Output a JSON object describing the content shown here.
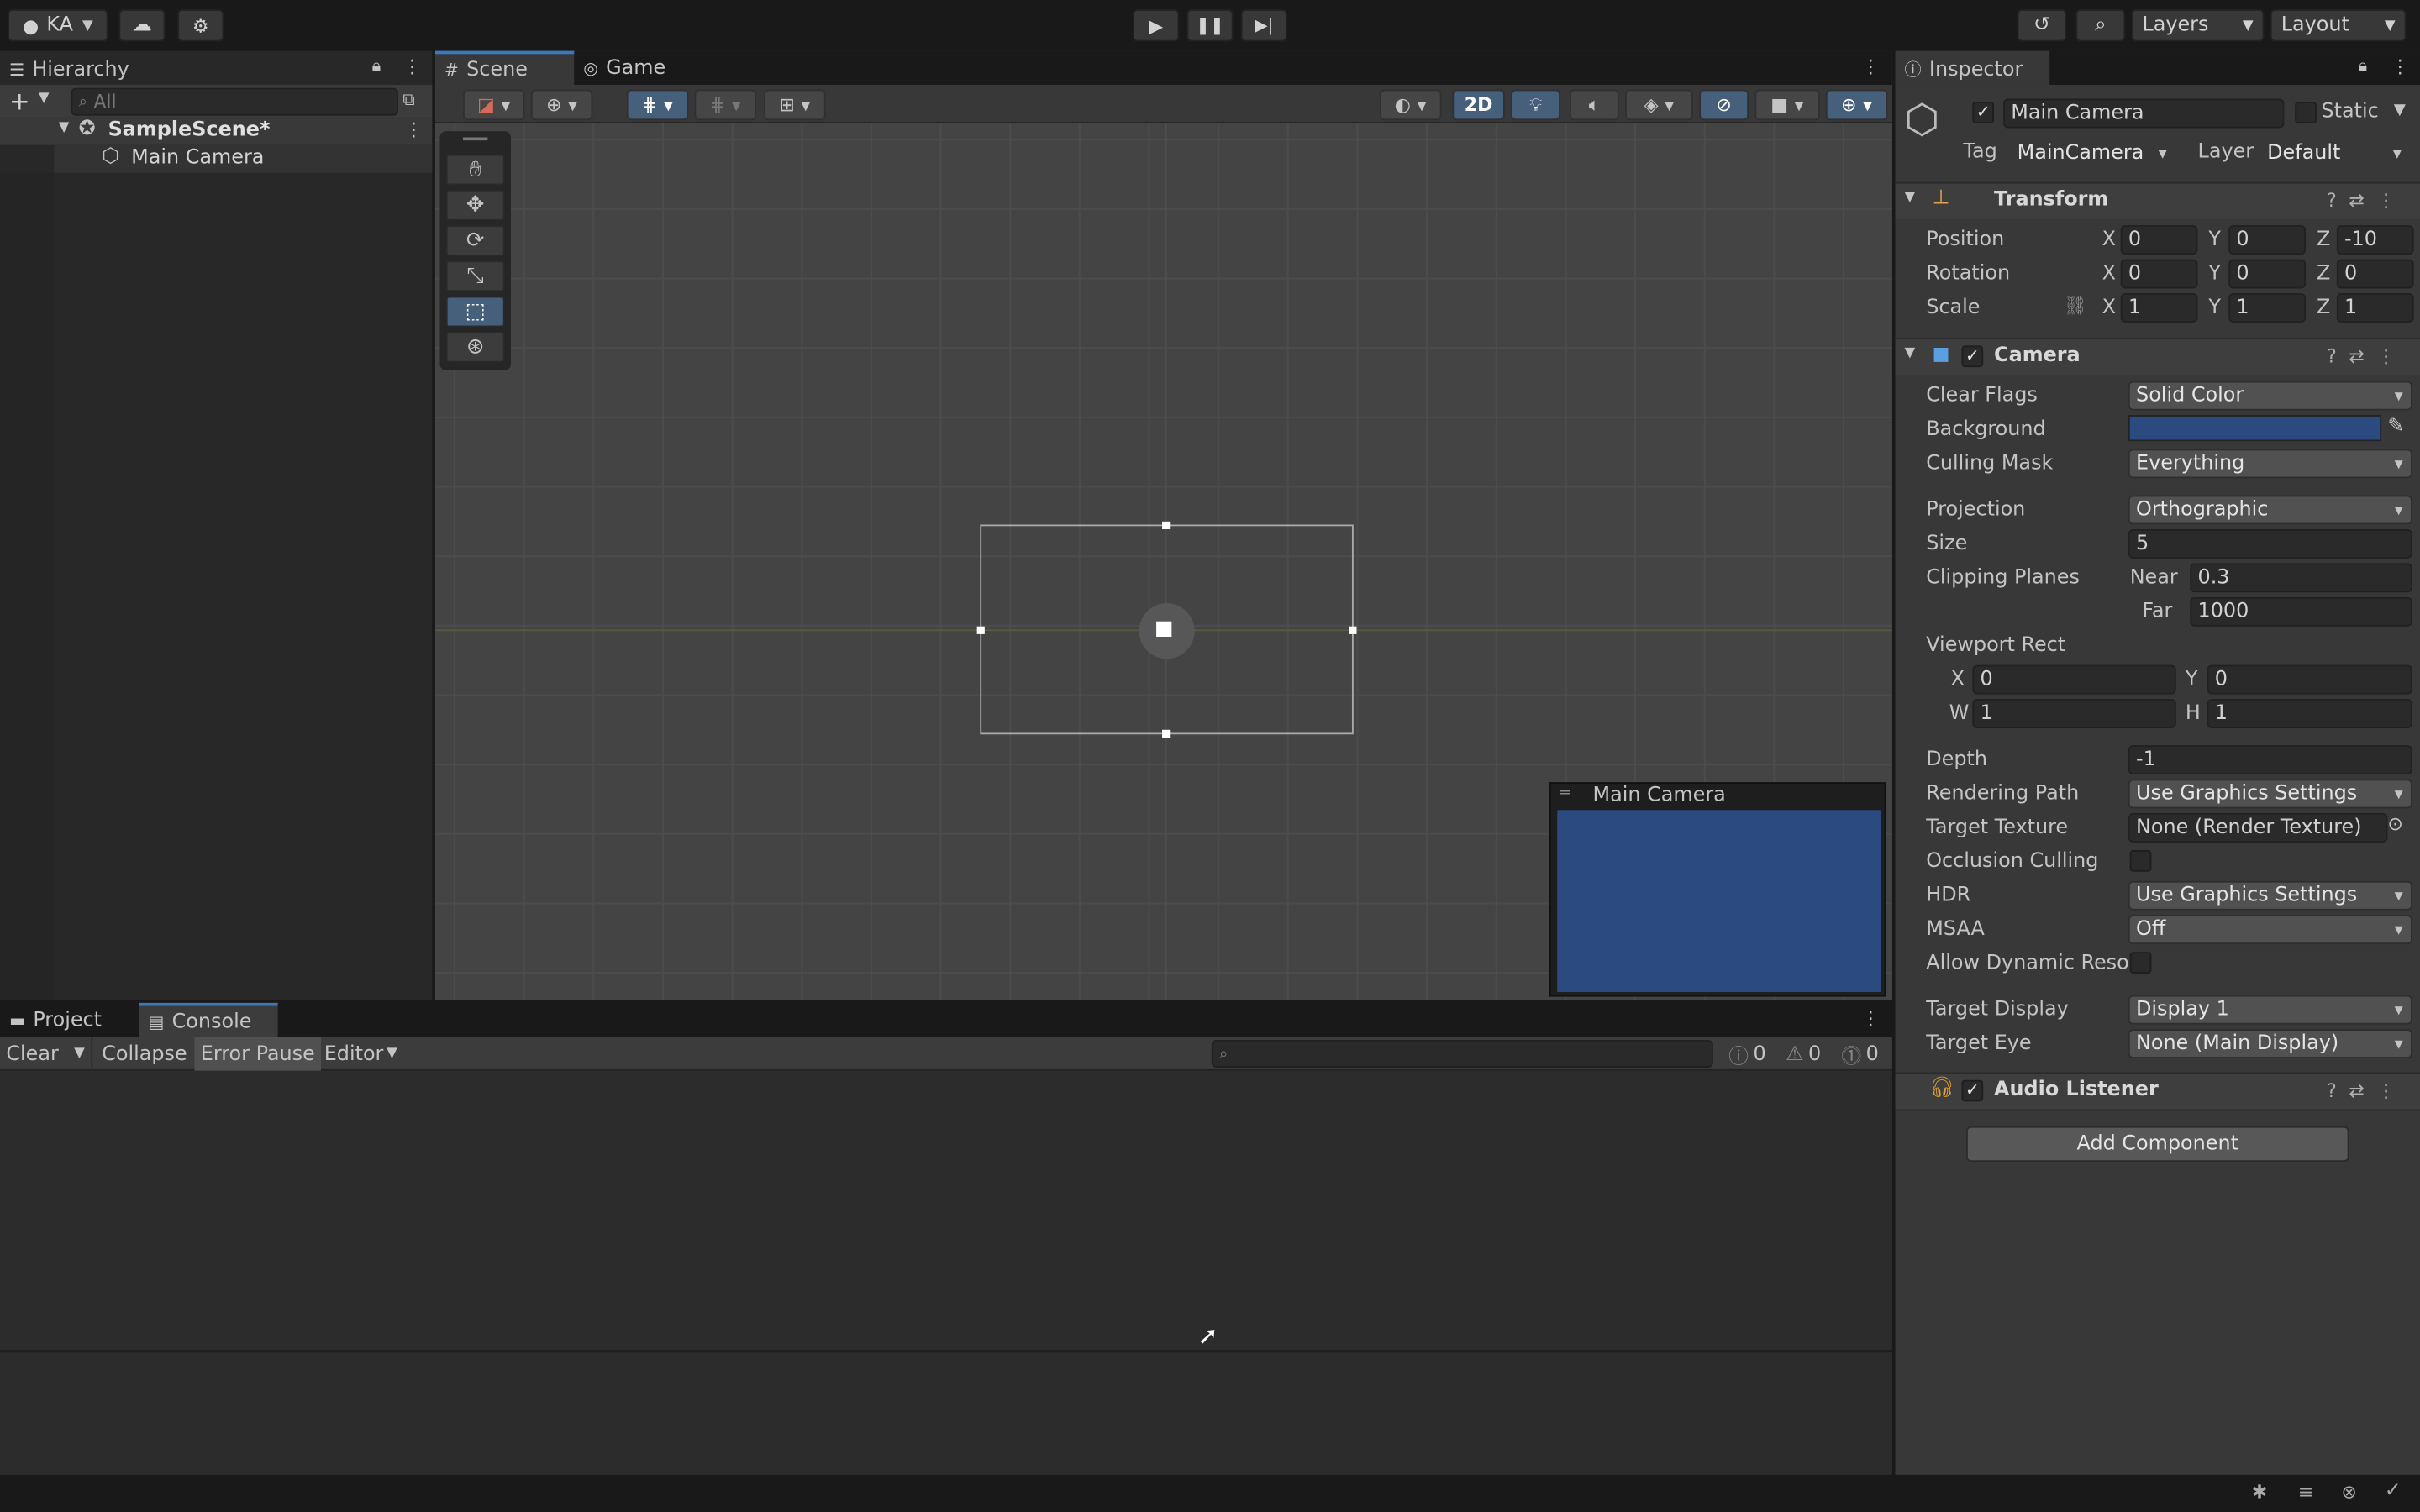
{
  "toolbar": {
    "account": "KA",
    "layers": "Layers",
    "layout": "Layout"
  },
  "hierarchy": {
    "tab": "Hierarchy",
    "search_placeholder": "All",
    "scene": "SampleScene*",
    "items": [
      "Main Camera"
    ]
  },
  "scene": {
    "tab_scene": "Scene",
    "tab_game": "Game",
    "mode_2d": "2D",
    "preview_title": "Main Camera",
    "preview_color": "#2b4a80"
  },
  "bottom": {
    "tab_project": "Project",
    "tab_console": "Console",
    "clear": "Clear",
    "collapse": "Collapse",
    "error_pause": "Error Pause",
    "editor": "Editor",
    "count_info": "0",
    "count_warn": "0",
    "count_error": "0"
  },
  "inspector": {
    "tab": "Inspector",
    "object_name": "Main Camera",
    "static_label": "Static",
    "tag_label": "Tag",
    "tag_value": "MainCamera",
    "layer_label": "Layer",
    "layer_value": "Default",
    "transform": {
      "title": "Transform",
      "position_label": "Position",
      "rotation_label": "Rotation",
      "scale_label": "Scale",
      "position": {
        "x": "0",
        "y": "0",
        "z": "-10"
      },
      "rotation": {
        "x": "0",
        "y": "0",
        "z": "0"
      },
      "scale": {
        "x": "1",
        "y": "1",
        "z": "1"
      }
    },
    "camera": {
      "title": "Camera",
      "clear_flags_label": "Clear Flags",
      "clear_flags": "Solid Color",
      "background_label": "Background",
      "background_color": "#2b4a80",
      "culling_mask_label": "Culling Mask",
      "culling_mask": "Everything",
      "projection_label": "Projection",
      "projection": "Orthographic",
      "size_label": "Size",
      "size": "5",
      "clipping_label": "Clipping Planes",
      "near_label": "Near",
      "near": "0.3",
      "far_label": "Far",
      "far": "1000",
      "viewport_label": "Viewport Rect",
      "vx": "0",
      "vy": "0",
      "vw": "1",
      "vh": "1",
      "depth_label": "Depth",
      "depth": "-1",
      "rendering_path_label": "Rendering Path",
      "rendering_path": "Use Graphics Settings",
      "target_texture_label": "Target Texture",
      "target_texture": "None (Render Texture)",
      "occlusion_label": "Occlusion Culling",
      "hdr_label": "HDR",
      "hdr": "Use Graphics Settings",
      "msaa_label": "MSAA",
      "msaa": "Off",
      "dynamic_res_label": "Allow Dynamic Resol",
      "target_display_label": "Target Display",
      "target_display": "Display 1",
      "target_eye_label": "Target Eye",
      "target_eye": "None (Main Display)"
    },
    "audio_listener": {
      "title": "Audio Listener"
    },
    "add_component": "Add Component"
  }
}
